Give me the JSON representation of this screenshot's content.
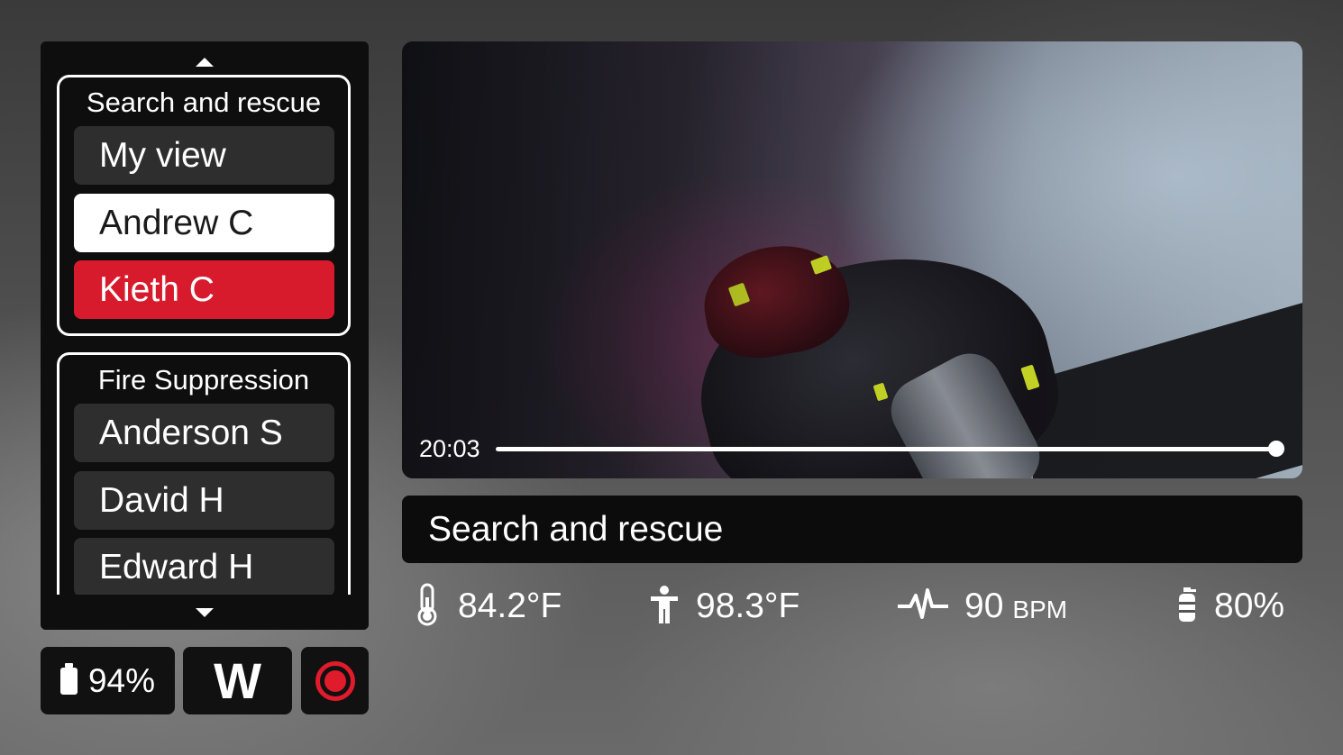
{
  "sidebar": {
    "groups": [
      {
        "title": "Search and rescue",
        "members": [
          {
            "label": "My view",
            "state": "default"
          },
          {
            "label": "Andrew C",
            "state": "selected"
          },
          {
            "label": "Kieth C",
            "state": "alert"
          }
        ]
      },
      {
        "title": "Fire Suppression",
        "members": [
          {
            "label": "Anderson S",
            "state": "default"
          },
          {
            "label": "David H",
            "state": "default"
          },
          {
            "label": "Edward H",
            "state": "default"
          }
        ]
      }
    ],
    "scroll_up_icon": "triangle-up-icon",
    "scroll_down_icon": "triangle-down-icon"
  },
  "status": {
    "battery_icon": "battery-icon",
    "battery": "94%",
    "heading": "W",
    "record_icon": "record-icon"
  },
  "video": {
    "elapsed": "20:03",
    "progress": 1.0
  },
  "title_bar": {
    "title": "Search and rescue"
  },
  "metrics": {
    "ambient_temp": {
      "icon": "thermometer-icon",
      "value": "84.2°F"
    },
    "body_temp": {
      "icon": "person-icon",
      "value": "98.3°F"
    },
    "heart_rate": {
      "icon": "heartbeat-icon",
      "value": "90",
      "unit": "BPM"
    },
    "air_supply": {
      "icon": "air-tank-icon",
      "value": "80%"
    }
  },
  "colors": {
    "alert": "#d81b2c",
    "record": "#e01b2b",
    "panel": "#0e0e0e",
    "member_default": "#2e2e2e",
    "member_selected": "#ffffff"
  }
}
